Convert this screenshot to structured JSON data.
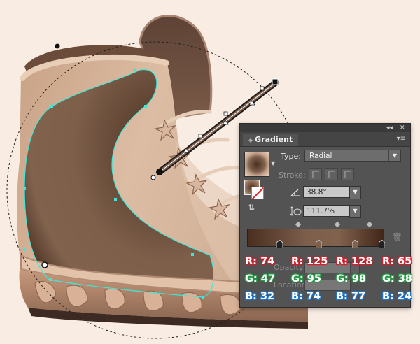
{
  "colors": {
    "background": "#f8ece3",
    "boot_light": "#d9b79e",
    "boot_dark": "#6b4b39",
    "path_color": "#3ee6d8",
    "panel_bg": "#535353",
    "red_label": "#d7202c",
    "green_label": "#2a9e4a",
    "blue_label": "#2277cc"
  },
  "panel": {
    "title": "Gradient",
    "type_label": "Type:",
    "type_value": "Radial",
    "stroke_label": "Stroke:",
    "angle_value": "38.8°",
    "aspect_value": "111.7%",
    "opacity_label": "Opacity:",
    "location_label": "Location:",
    "icons": [
      "collapse-icon",
      "close-icon",
      "panel-menu-icon",
      "gradient-thumbnail",
      "reverse-gradient-icon",
      "angle-icon",
      "aspect-ratio-icon",
      "trash-icon"
    ]
  },
  "gradient_stops": [
    {
      "r": "R: 74",
      "g": "G: 47",
      "b": "B: 32",
      "color": "#4a2f20"
    },
    {
      "r": "R: 125",
      "g": "G: 95",
      "b": "B: 74",
      "color": "#7d5f4a"
    },
    {
      "r": "R: 128",
      "g": "G: 98",
      "b": "B: 77",
      "color": "#80624d"
    },
    {
      "r": "R: 65",
      "g": "G: 38",
      "b": "B: 24",
      "color": "#412618"
    }
  ]
}
